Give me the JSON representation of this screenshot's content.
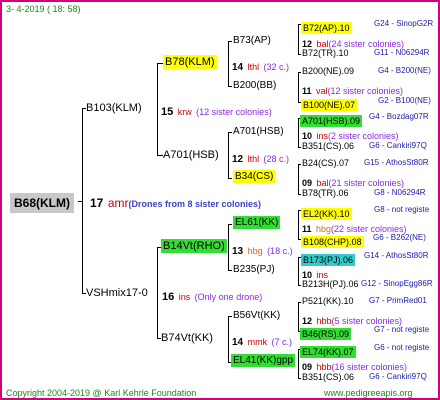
{
  "header": {
    "date": "3-  4-2019  ( 18:  58)"
  },
  "root": {
    "name": "B68(KLM)",
    "family_number": "17",
    "family_code": "amr",
    "drones_note": "(Drones from 8 sister colonies)"
  },
  "gen2": [
    {
      "name": "B103(KLM)",
      "family_number": "15",
      "family_code": "krw",
      "sister_note": "(12 sister colonies)"
    },
    {
      "name": "VSHmix17-0",
      "family_number": "16",
      "family_code": "ins",
      "sister_note": "(Only one drone)"
    }
  ],
  "gen3": [
    {
      "name": "B78(KLM)",
      "family_number": "14",
      "family_code": "lthl",
      "sister_note": "(32 c.)"
    },
    {
      "name": "A701(HSB)",
      "family_number": "12",
      "family_code": "lthl",
      "sister_note": "(28 c.)"
    },
    {
      "name": "B14Vt(RHO)",
      "family_number": "13",
      "family_code": "hbg",
      "sister_note": "(18 c.)"
    },
    {
      "name": "B74Vt(KK)",
      "family_number": "14",
      "family_code": "mmk",
      "sister_note": "(7 c.)"
    }
  ],
  "gen4": [
    {
      "name": "B73(AP)",
      "family_number": "12",
      "family_code": "bal",
      "sister_note": "(24 sister colonies)"
    },
    {
      "name": "B200(BB)",
      "family_number": "11",
      "family_code": "val",
      "sister_note": "(12 sister colonies)"
    },
    {
      "name": "A701(HSB)",
      "family_number": "10",
      "family_code": "ins",
      "sister_note": "(2 sister colonies)"
    },
    {
      "name": "B34(CS)",
      "family_number": "09",
      "family_code": "bal",
      "sister_note": "(21 sister colonies)"
    },
    {
      "name": "EL61(KK)",
      "family_number": "11",
      "family_code": "hbg",
      "sister_note": "(22 sister colonies)"
    },
    {
      "name": "B235(PJ)",
      "family_number": "10",
      "family_code": "ins",
      "sister_note": ""
    },
    {
      "name": "B56Vt(KK)",
      "family_number": "12",
      "family_code": "hbb",
      "sister_note": "(5 sister colonies)"
    },
    {
      "name": "EL41(KK)gpp",
      "family_number": "09",
      "family_code": "hbb",
      "sister_note": "(16 sister colonies)"
    }
  ],
  "gen5": [
    {
      "name": "B72(AP).10",
      "ref": "G24 - SinopG2R"
    },
    {
      "name": "B72(TR).10",
      "ref": "G11 - N06294R"
    },
    {
      "name": "B200(NE).09",
      "ref": "G4 - B200(NE)"
    },
    {
      "name": "B100(NE).07",
      "ref": "G2 - B100(NE)"
    },
    {
      "name": "A701(HSB).09",
      "ref": "G4 - Bozdag07R"
    },
    {
      "name": "B351(CS).06",
      "ref": "G6 - Cankiri97Q"
    },
    {
      "name": "B24(CS).07",
      "ref": "G15 - AthosSt80R"
    },
    {
      "name": "B78(TR).06",
      "ref": "G8 - N06294R"
    },
    {
      "name": "EL2(KK).10",
      "ref": "G8 - not registe"
    },
    {
      "name": "B108(CHP).08",
      "ref": "G6 - B262(NE)"
    },
    {
      "name": "B173(PJ).06",
      "ref": "G14 - AthosSt80R"
    },
    {
      "name": "B213H(PJ).06",
      "ref": "G12 - SinopEgg86R"
    },
    {
      "name": "P521(KK).10",
      "ref": "G7 - PrimRed01"
    },
    {
      "name": "B46(RS).09",
      "ref": "G7 - not registe"
    },
    {
      "name": "EL74(KK).07",
      "ref": "G6 - not registe"
    },
    {
      "name": "B351(CS).06",
      "ref": "G6 - Cankiri97Q"
    }
  ],
  "footer": {
    "copyright": "Copyright 2004-2019 @ Karl Kehrle Foundation",
    "website": "www.pedigreeapis.org"
  }
}
